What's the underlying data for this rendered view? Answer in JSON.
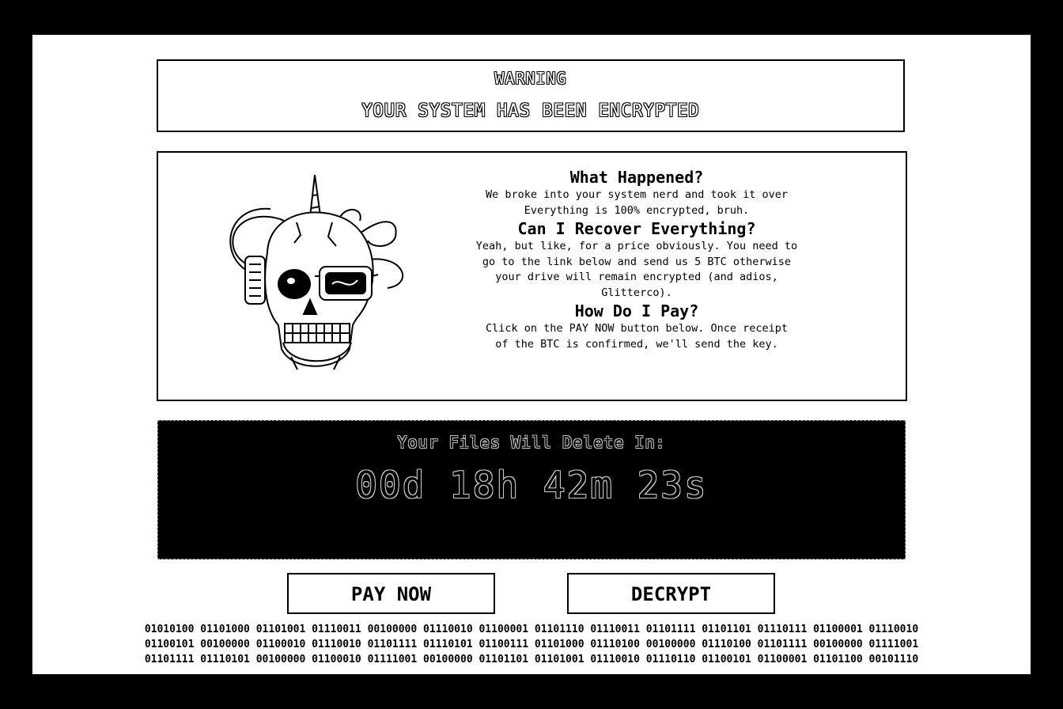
{
  "banner": {
    "warning": "WARNING",
    "subtitle": "YOUR SYSTEM HAS BEEN ENCRYPTED"
  },
  "info": {
    "image_icon": "skull-icon",
    "sections": [
      {
        "heading": "What Happened?",
        "lines": [
          "We broke into your system nerd and took it over",
          "Everything is 100% encrypted, bruh."
        ]
      },
      {
        "heading": "Can I Recover Everything?",
        "lines": [
          "Yeah, but like, for a price obviously. You need to",
          "go to the link below and send us 5 BTC otherwise",
          "your drive will remain encrypted (and adios,",
          "Glitterco)."
        ]
      },
      {
        "heading": "How Do I Pay?",
        "lines": [
          "Click on the PAY NOW button below. Once receipt",
          "of the BTC is confirmed, we'll send the key."
        ]
      }
    ]
  },
  "timer": {
    "label": "Your Files Will Delete In:",
    "countdown": "00d 18h 42m 23s"
  },
  "buttons": {
    "pay_now": "PAY NOW",
    "decrypt": "DECRYPT"
  },
  "binary_lines": [
    "01010100 01101000 01101001 01110011 00100000 01110010 01100001 01101110 01110011 01101111 01101101 01110111 01100001 01110010",
    "01100101 00100000 01100010 01110010 01101111 01110101 01100111 01101000 01110100 00100000 01110100 01101111 00100000 01111001",
    "01101111 01110101 00100000 01100010 01111001 00100000 01101101 01101001 01110010 01110110 01100101 01100001 01101100 00101110"
  ]
}
